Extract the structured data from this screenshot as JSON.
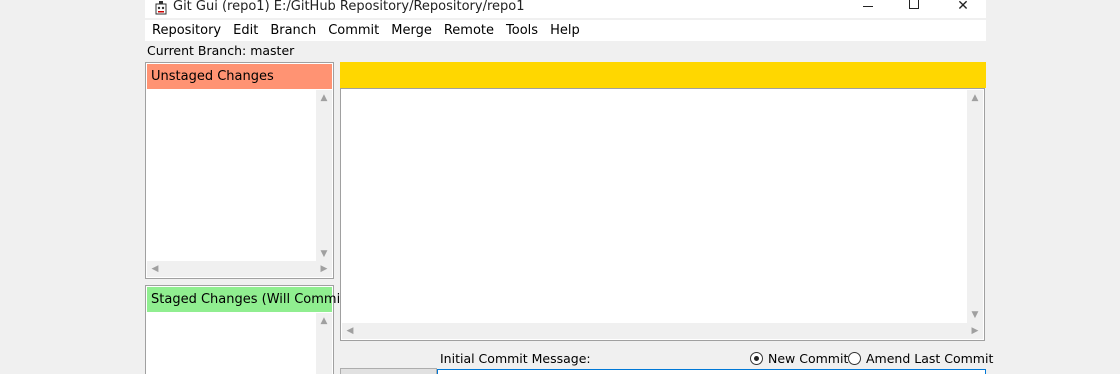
{
  "window": {
    "title": "Git Gui (repo1) E:/GitHub Repository/Repository/repo1",
    "controls": {
      "minimize": "minimize-icon",
      "maximize": "maximize-icon",
      "close": "✕"
    }
  },
  "menu": [
    "Repository",
    "Edit",
    "Branch",
    "Commit",
    "Merge",
    "Remote",
    "Tools",
    "Help"
  ],
  "status": {
    "current_branch": "Current Branch: master"
  },
  "unstaged": {
    "header": "Unstaged Changes",
    "color": "#ff9373"
  },
  "staged": {
    "header": "Staged Changes (Will Commit)",
    "color": "#90ee90"
  },
  "diff": {
    "header_color": "#ffd700"
  },
  "commit": {
    "message_label": "Initial Commit Message:",
    "new_commit": "New Commit",
    "amend": "Amend Last Commit",
    "selected": "New Commit"
  },
  "icons": {
    "up": "▲",
    "down": "▼",
    "left": "◀",
    "right": "▶"
  }
}
